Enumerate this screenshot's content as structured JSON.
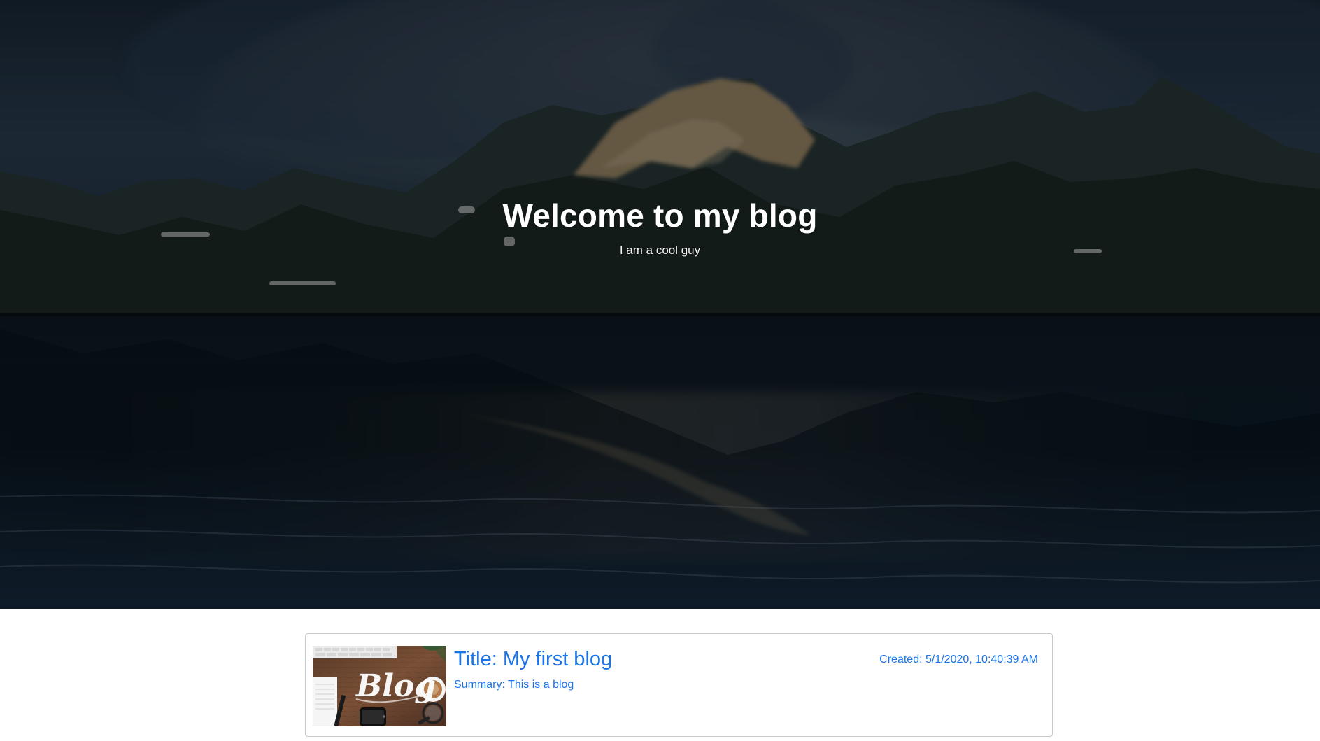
{
  "hero": {
    "title": "Welcome to my blog",
    "subtitle": "I am a cool guy"
  },
  "posts": [
    {
      "title": "Title: My first blog",
      "summary": "Summary: This is a blog",
      "created": "Created: 5/1/2020, 10:40:39 AM",
      "thumbnail_text": "Blog"
    }
  ],
  "colors": {
    "link_blue": "#1a73e8",
    "card_border": "#c8c8c8",
    "hero_overlay": "rgba(0,0,0,0.38)"
  }
}
